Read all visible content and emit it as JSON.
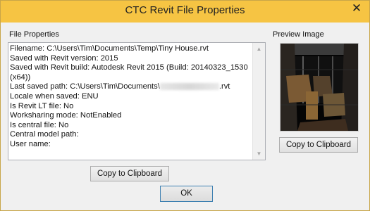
{
  "window": {
    "title": "CTC Revit File Properties",
    "close_glyph": "✕"
  },
  "file_properties": {
    "label": "File Properties",
    "filename": "Filename: C:\\Users\\Tim\\Documents\\Temp\\Tiny House.rvt",
    "saved_version": "Saved with Revit version: 2015",
    "saved_build_1": "Saved with Revit build: Autodesk Revit 2015 (Build: 20140323_1530",
    "saved_build_2": "(x64))",
    "last_saved_prefix": "Last saved path: C:\\Users\\Tim\\Documents\\",
    "last_saved_suffix": ".rvt",
    "locale": "Locale when saved: ENU",
    "is_lt": "Is Revit LT file: No",
    "worksharing": "Worksharing mode: NotEnabled",
    "is_central": "Is central file: No",
    "central_path": "Central model path:",
    "user_name": "User name:",
    "copy_button": "Copy to Clipboard"
  },
  "preview": {
    "label": "Preview Image",
    "copy_button": "Copy to Clipboard"
  },
  "ok_button": "OK",
  "colors": {
    "titlebar": "#f6c443",
    "accent_border": "#3c7fb1"
  }
}
